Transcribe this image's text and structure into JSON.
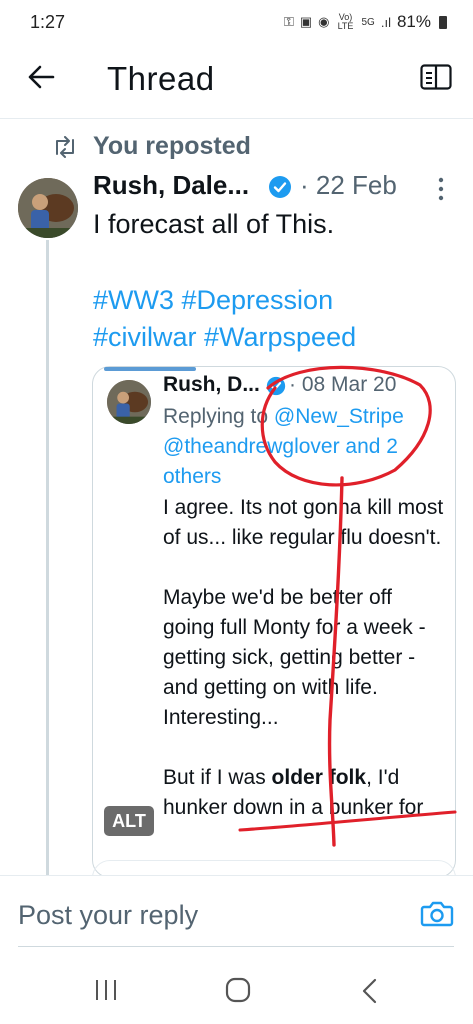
{
  "status_bar": {
    "time": "1:27",
    "network_label": "Vo) LTE",
    "signal_label": "5G",
    "battery": "81%"
  },
  "header": {
    "title": "Thread"
  },
  "repost": {
    "label": "You reposted"
  },
  "tweet": {
    "author": "Rush, Dale...",
    "date": "· 22 Feb",
    "text": "I forecast all of This.",
    "hashtags_line1": "#WW3 #Depression",
    "hashtags_line2": "#civilwar #Warpspeed"
  },
  "quoted": {
    "author": "Rush, D...",
    "date": "· 08 Mar 20",
    "replying_prefix": "Replying to ",
    "mention1": "@New_Stripe",
    "mention2": "@theandrewglover and 2 others",
    "para1": "I agree. Its not gonna kill most of us... like regular flu doesn't.",
    "para2": "Maybe we'd be better off going full Monty for a week - getting sick, getting better - and getting on with life. Interesting...",
    "para3_prefix": "But if I was ",
    "para3_bold": "older folk",
    "para3_suffix": ", I'd hunker down in a bunker for",
    "alt_badge": "ALT"
  },
  "reply": {
    "placeholder": "Post your reply"
  },
  "colors": {
    "accent": "#1d9bf0",
    "annotation": "#e0202a",
    "secondary_text": "#536471"
  }
}
